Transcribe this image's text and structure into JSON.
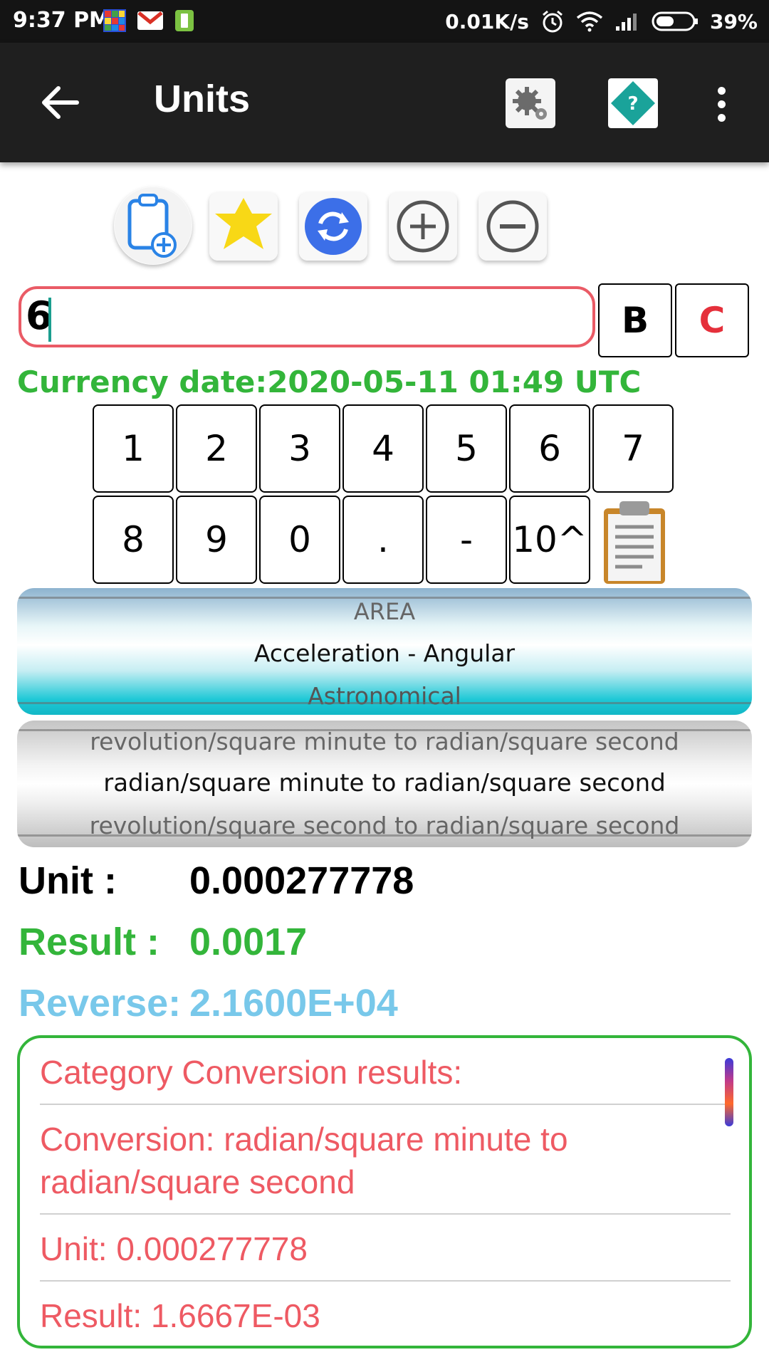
{
  "status_bar": {
    "time": "9:37 PM",
    "speed": "0.01K/s",
    "battery": "39%"
  },
  "app_bar": {
    "title": "Units"
  },
  "input": {
    "value": "6",
    "backspace_label": "B",
    "clear_label": "C"
  },
  "currency_date": "Currency date:2020-05-11 01:49 UTC",
  "keypad": {
    "row1": [
      "1",
      "2",
      "3",
      "4",
      "5",
      "6",
      "7"
    ],
    "row2": [
      "8",
      "9",
      "0",
      ".",
      "-",
      "10^"
    ]
  },
  "category_picker": {
    "prev": "AREA",
    "selected": "Acceleration - Angular",
    "next": "Astronomical"
  },
  "conversion_picker": {
    "prev": "revolution/square minute to radian/square second",
    "selected": "radian/square minute to radian/square second",
    "next": "revolution/square second to radian/square second"
  },
  "unit": {
    "label": "Unit :",
    "value": "0.000277778"
  },
  "result": {
    "label": "Result :",
    "value": "0.0017"
  },
  "reverse": {
    "label": "Reverse:",
    "value": "2.1600E+04"
  },
  "results_list": [
    "Category Conversion results:",
    "Conversion: radian/square minute to radian/square second",
    "Unit: 0.000277778",
    "Result: 1.6667E-03"
  ],
  "colors": {
    "green": "#33b53a",
    "red": "#ea5b66",
    "reverse_blue": "#78c8ea",
    "clear_red": "#e5303b"
  },
  "icons": [
    "back-arrow-icon",
    "settings-gear-icon",
    "help-icon",
    "overflow-menu-icon",
    "clipboard-add-icon",
    "star-icon",
    "sync-icon",
    "plus-circle-icon",
    "minus-circle-icon",
    "paste-icon"
  ]
}
